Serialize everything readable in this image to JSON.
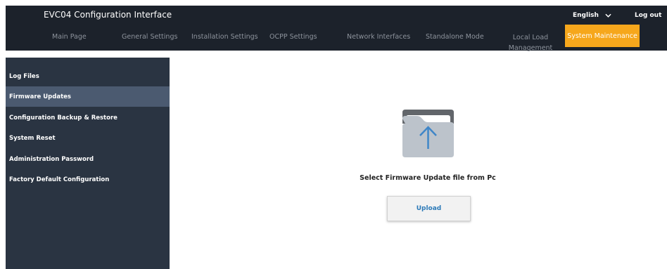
{
  "header": {
    "app_title": "EVC04 Configuration Interface",
    "language": "English",
    "logout_label": "Log out",
    "icons": {
      "language_dropdown": "chevron-down-icon"
    }
  },
  "nav": {
    "items": [
      {
        "label": "Main Page"
      },
      {
        "label": "General Settings"
      },
      {
        "label": "Installation Settings"
      },
      {
        "label": "OCPP Settings"
      },
      {
        "label": "Network Interfaces"
      },
      {
        "label": "Standalone Mode"
      },
      {
        "label": "Local Load Management"
      },
      {
        "label": "System Maintenance"
      }
    ],
    "active_index": 7
  },
  "sidebar": {
    "items": [
      {
        "label": "Log Files"
      },
      {
        "label": "Firmware Updates"
      },
      {
        "label": "Configuration Backup & Restore"
      },
      {
        "label": "System Reset"
      },
      {
        "label": "Administration Password"
      },
      {
        "label": "Factory Default Configuration"
      }
    ],
    "active_index": 1
  },
  "main": {
    "icon": "folder-upload-icon",
    "select_text": "Select Firmware Update file from Pc",
    "upload_label": "Upload"
  },
  "colors": {
    "header_bg": "#1c222b",
    "sidebar_bg": "#2a3442",
    "sidebar_active": "#4b5a70",
    "accent": "#f6a71c",
    "upload_text": "#2d7ab8"
  }
}
